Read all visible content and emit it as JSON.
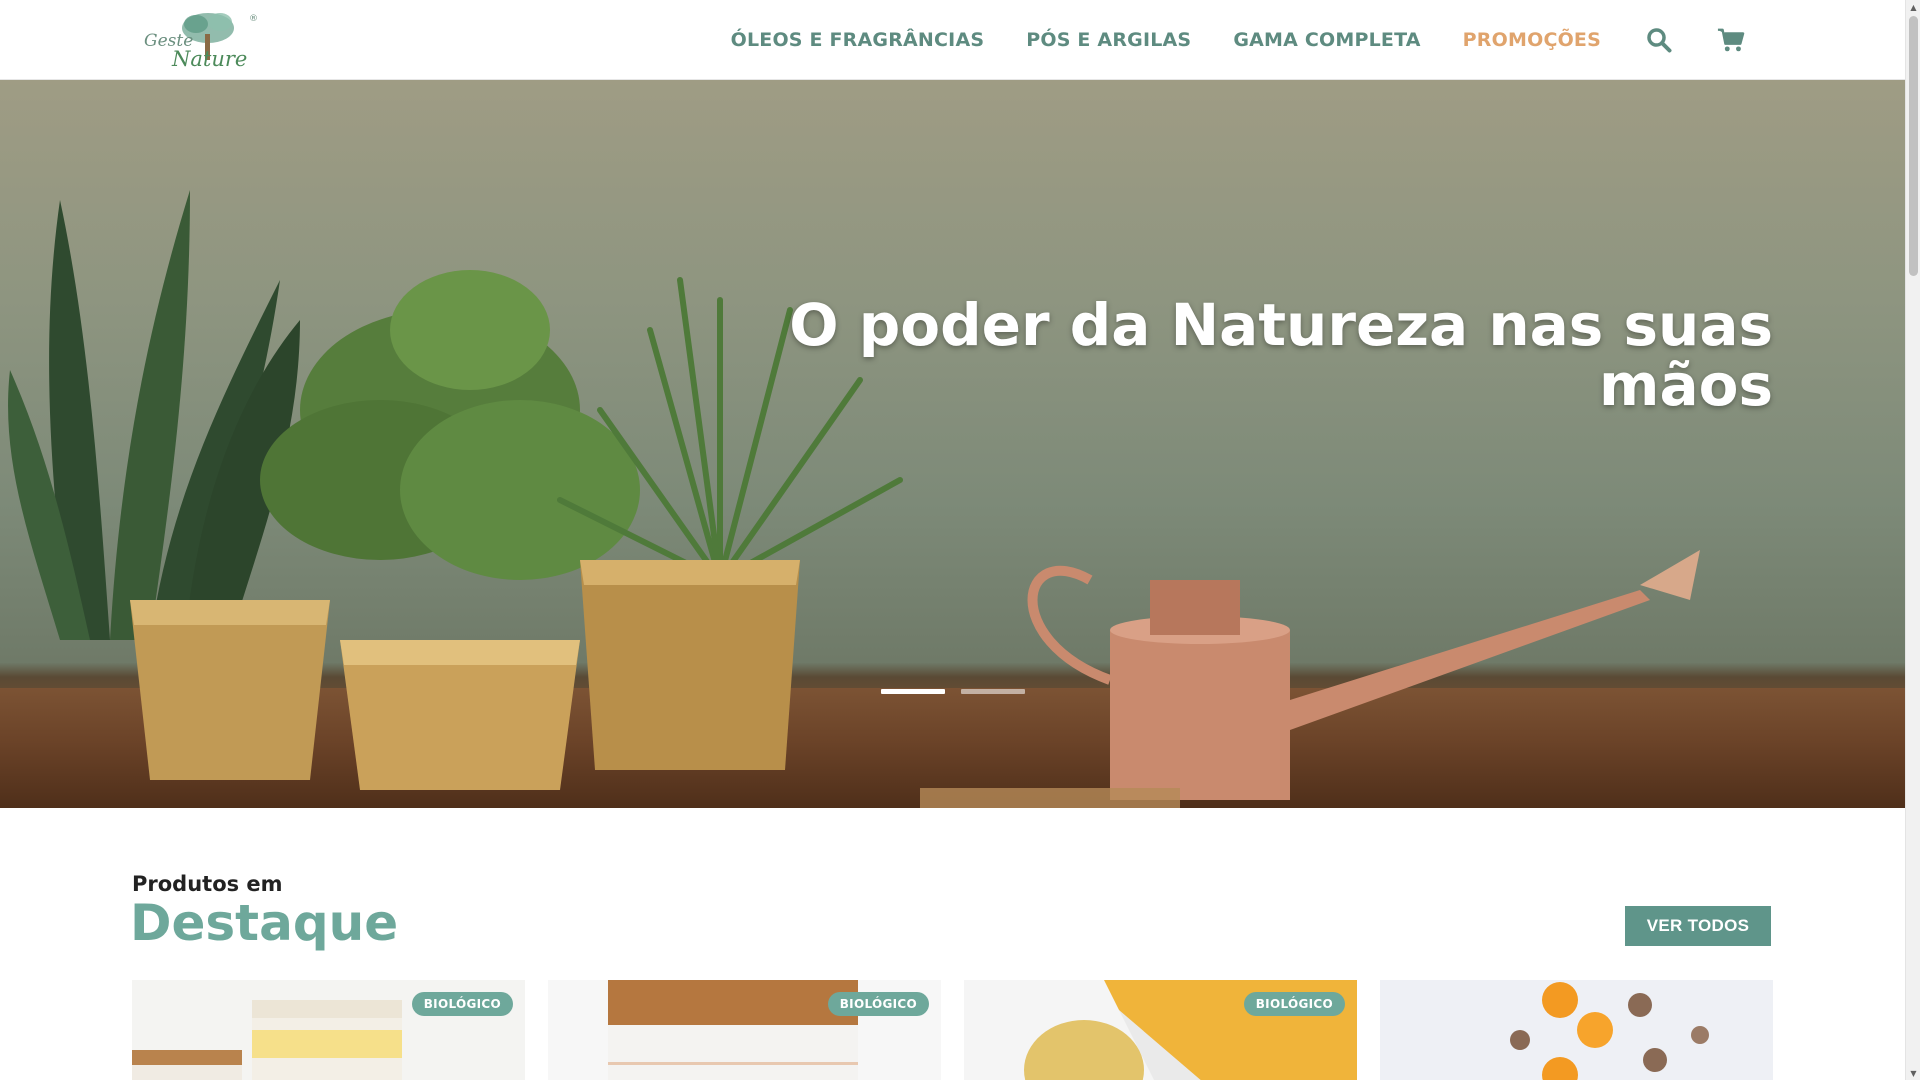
{
  "brand": {
    "logo_line1": "Geste",
    "logo_line2": "Nature",
    "logo_mark": "®"
  },
  "nav": {
    "items": [
      {
        "label": "ÓLEOS E FRAGRÂNCIAS"
      },
      {
        "label": "PÓS E ARGILAS"
      },
      {
        "label": "GAMA COMPLETA"
      },
      {
        "label": "PROMOÇÕES"
      }
    ],
    "search_icon": "search-icon",
    "cart_icon": "cart-icon"
  },
  "hero": {
    "title": "O poder da Natureza nas suas mãos",
    "slides_count": 2,
    "active_slide": 1
  },
  "featured": {
    "subtitle": "Produtos em",
    "title": "Destaque",
    "view_all_label": "VER TODOS",
    "products": [
      {
        "badge": "BIOLÓGICO"
      },
      {
        "badge": "BIOLÓGICO"
      },
      {
        "badge": "BIOLÓGICO"
      },
      {
        "badge": ""
      }
    ]
  },
  "colors": {
    "accent": "#6ea89b",
    "nav_text": "#5e8b80",
    "promo": "#e0a46d",
    "button": "#5f958a"
  }
}
